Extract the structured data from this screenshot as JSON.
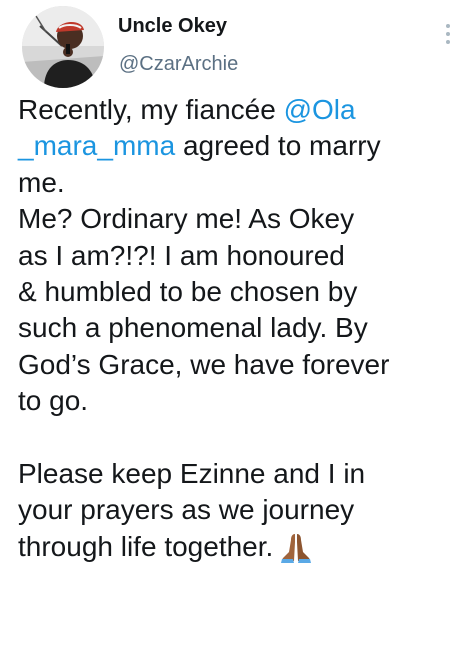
{
  "author": {
    "display_name": "Uncle Okey",
    "handle": "@CzarArchie"
  },
  "tweet": {
    "line_1": "Recently, my fiancée",
    "mention_1": "@Ola",
    "mention_2": "_mara_mma",
    "line_2_rest": " agreed to marry",
    "line_3": "me.",
    "line_4": "Me? Ordinary me! As Okey",
    "line_5": "as I am?!?! I am honoured",
    "line_6": "& humbled to be chosen by",
    "line_7": "such a phenomenal lady. By",
    "line_8": "God’s Grace, we have forever",
    "line_9": "to go.",
    "line_10": "Please keep Ezinne and I in",
    "line_11": "your prayers as we journey",
    "line_12": "through life together.",
    "emoji": "folded-hands-emoji"
  },
  "colors": {
    "text": "#14171a",
    "secondary": "#5b7083",
    "link": "#1b95e0"
  }
}
